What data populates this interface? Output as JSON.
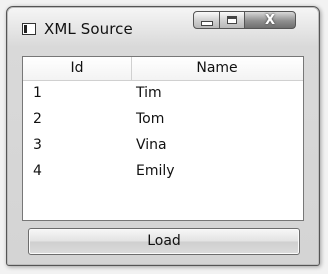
{
  "window": {
    "title": "XML Source",
    "controls": {
      "minimize": "minimize-icon",
      "maximize": "maximize-icon",
      "close": "close-icon",
      "close_glyph": "X"
    }
  },
  "grid": {
    "columns": [
      "Id",
      "Name"
    ],
    "rows": [
      {
        "id": "1",
        "name": "Tim"
      },
      {
        "id": "2",
        "name": "Tom"
      },
      {
        "id": "3",
        "name": "Vina"
      },
      {
        "id": "4",
        "name": "Emily"
      }
    ]
  },
  "actions": {
    "load_label": "Load"
  }
}
